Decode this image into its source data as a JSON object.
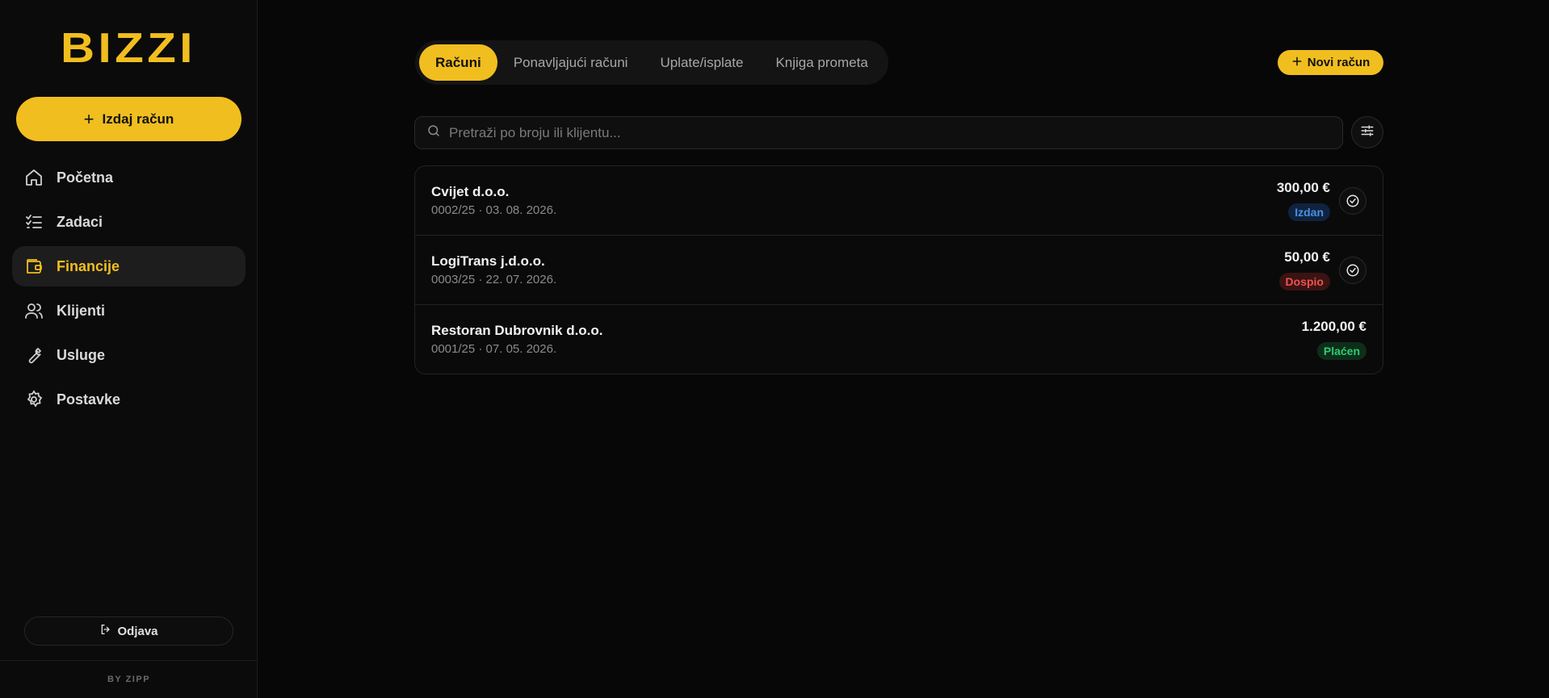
{
  "sidebar": {
    "logo": "BIZZI",
    "issue_button": "Izdaj račun",
    "items": [
      {
        "label": "Početna",
        "icon": "home-icon",
        "active": false
      },
      {
        "label": "Zadaci",
        "icon": "checklist-icon",
        "active": false
      },
      {
        "label": "Financije",
        "icon": "wallet-icon",
        "active": true
      },
      {
        "label": "Klijenti",
        "icon": "users-icon",
        "active": false
      },
      {
        "label": "Usluge",
        "icon": "wrench-icon",
        "active": false
      },
      {
        "label": "Postavke",
        "icon": "gear-icon",
        "active": false
      }
    ],
    "logout": "Odjava",
    "footer": "BY ZIPP"
  },
  "tabs": [
    {
      "label": "Računi",
      "active": true
    },
    {
      "label": "Ponavljajući računi",
      "active": false
    },
    {
      "label": "Uplate/isplate",
      "active": false
    },
    {
      "label": "Knjiga prometa",
      "active": false
    }
  ],
  "new_button": "Novi račun",
  "search": {
    "placeholder": "Pretraži po broju ili klijentu...",
    "value": ""
  },
  "invoices": [
    {
      "client": "Cvijet d.o.o.",
      "meta": "0002/25 · 03. 08. 2026.",
      "amount": "300,00 €",
      "status": "Izdan",
      "status_color": "#4a90e2",
      "status_bg": "#0f2340",
      "action": true
    },
    {
      "client": "LogiTrans j.d.o.o.",
      "meta": "0003/25 · 22. 07. 2026.",
      "amount": "50,00 €",
      "status": "Dospio",
      "status_color": "#f0524f",
      "status_bg": "#3a1313",
      "action": true
    },
    {
      "client": "Restoran Dubrovnik d.o.o.",
      "meta": "0001/25 · 07. 05. 2026.",
      "amount": "1.200,00 €",
      "status": "Plaćen",
      "status_color": "#2ecc71",
      "status_bg": "#0e2e1b",
      "action": false
    }
  ],
  "colors": {
    "accent": "#f1be1f",
    "background": "#070707"
  }
}
